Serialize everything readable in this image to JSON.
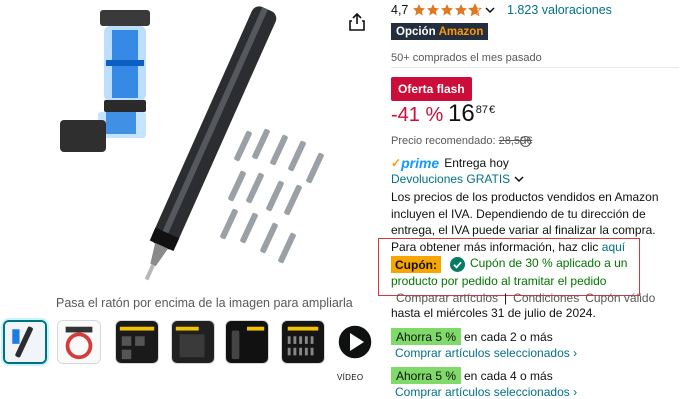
{
  "image_gallery": {
    "zoom_hint": "Pasa el ratón por encima de la imagen para ampliarla",
    "video_label": "VÍDEO"
  },
  "product": {
    "rating": "4,7",
    "ratings_link": "1.823 valoraciones",
    "badge": {
      "prefix": "Opción",
      "brand": "Amazon"
    },
    "bought": "50+ comprados el mes pasado",
    "flash_deal": "Oferta flash",
    "discount": "-41 %",
    "price": {
      "integer": "16",
      "decimal": "87",
      "currency": "€"
    },
    "recommended": {
      "label": "Precio recomendado:",
      "old_price": "28,59€"
    },
    "prime": {
      "check": "✓",
      "word": "prime",
      "delivery": "Entrega hoy"
    },
    "returns": "Devoluciones GRATIS",
    "vat_text": "Los precios de los productos vendidos en Amazon incluyen el IVA. Dependiendo de tu dirección de entrega, el IVA puede variar al finalizar la compra. Para obtener más información, haz clic ",
    "vat_link": "aquí",
    "coupon": {
      "label": "Cupón:",
      "line1": "Cupón de 30 % aplicado a un",
      "line2": "producto por pedido al tramitar el pedido"
    },
    "terms": {
      "compare": "Comparar artículos",
      "sep": "|",
      "conditions": "Condiciones",
      "valid": "Cupón válido",
      "valid_until": "hasta el miércoles 31 de julio de 2024."
    },
    "offers": [
      {
        "tag": "Ahorra 5 %",
        "desc": "en cada 2 o más",
        "link": "Comprar artículos seleccionados ›"
      },
      {
        "tag": "Ahorra 5 %",
        "desc": "en cada 4 o más",
        "link": "Comprar artículos seleccionados ›"
      }
    ]
  },
  "colors": {
    "link": "#007185",
    "deal_red": "#cc0c39",
    "coupon_orange": "#f7a500",
    "coupon_green": "#007600",
    "save_green": "#7fda69",
    "star": "#de7921"
  }
}
